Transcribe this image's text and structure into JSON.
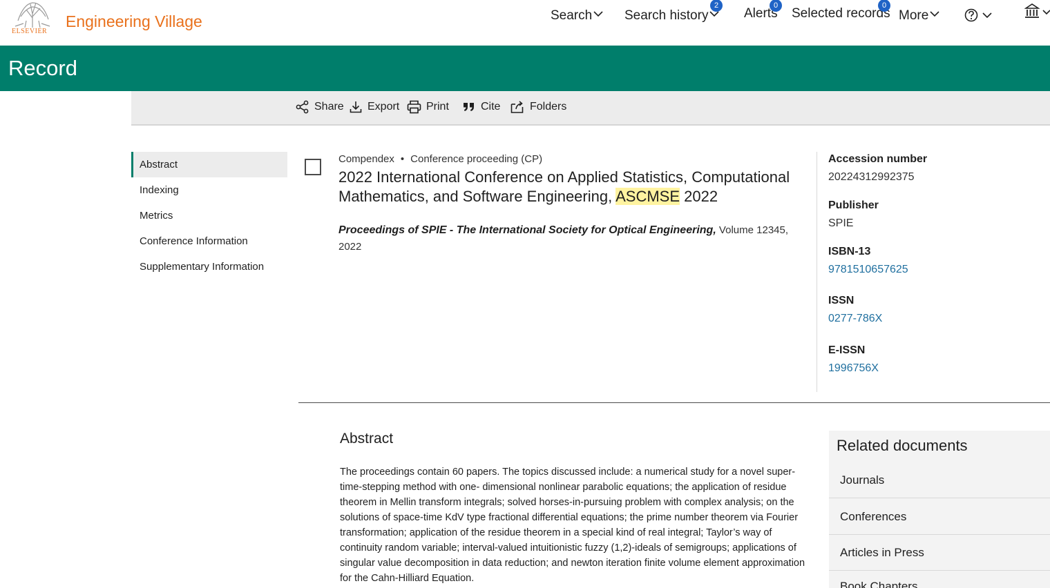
{
  "header": {
    "logo_word": "ELSEVIER",
    "brand": "Engineering Village",
    "nav": [
      {
        "label": "Search",
        "chevron": true
      },
      {
        "label": "Search history",
        "chevron": true,
        "badge": "2"
      },
      {
        "label": "Alerts",
        "badge": "0"
      },
      {
        "label": "Selected records",
        "badge": "0"
      },
      {
        "label": "More",
        "chevron": true
      }
    ],
    "help_icon": "help-circle-icon",
    "institution_icon": "institution-icon"
  },
  "banner": {
    "title": "Record"
  },
  "toolbar": {
    "items": [
      {
        "label": "Share",
        "icon": "share-icon"
      },
      {
        "label": "Export",
        "icon": "export-icon"
      },
      {
        "label": "Print",
        "icon": "print-icon"
      },
      {
        "label": "Cite",
        "icon": "cite-icon"
      },
      {
        "label": "Folders",
        "icon": "folder-icon"
      }
    ]
  },
  "sidenav": {
    "items": [
      "Abstract",
      "Indexing",
      "Metrics",
      "Conference Information",
      "Supplementary Information"
    ],
    "active_index": 0
  },
  "record": {
    "database": "Compendex",
    "doc_type": "Conference proceeding (CP)",
    "title_before": "2022 International Conference on Applied Statistics, Computational Mathematics, and Software Engineering, ",
    "title_highlight": "ASCMSE",
    "title_after": " 2022",
    "journal": "Proceedings of SPIE - The International Society for Optical Engineering,",
    "volume_year": " Volume 12345, 2022"
  },
  "meta": {
    "accession_label": "Accession number",
    "accession_value": "20224312992375",
    "publisher_label": "Publisher",
    "publisher_value": "SPIE",
    "isbn_label": "ISBN-13",
    "isbn_value": "9781510657625",
    "issn_label": "ISSN",
    "issn_value": "0277-786X",
    "eissn_label": "E-ISSN",
    "eissn_value": "1996756X"
  },
  "abstract": {
    "title": "Abstract",
    "text": "The proceedings contain 60 papers. The topics discussed include: a numerical study for a novel super-time-stepping method with one- dimensional nonlinear parabolic equations; the application of residue theorem in Mellin transform integrals; solved horses-in-pursuing problem with complex analysis; on the solutions of space-time KdV type fractional differential equations; the prime number theorem via Fourier transformation; application of the residue theorem in a special kind of real integral; Taylor’s way of continuity random variable; interval-valued intuitionistic fuzzy (1,2)-ideals of semigroups; applications of singular value decomposition in data reduction; and newton iteration finite volume element approximation for the Cahn-Hilliard Equation."
  },
  "related": {
    "title": "Related documents",
    "items": [
      "Journals",
      "Conferences",
      "Articles in Press",
      "Book Chapters"
    ]
  },
  "colors": {
    "brand_orange": "#e9711c",
    "banner_green": "#007e6b",
    "badge_blue": "#1f63c6",
    "link_blue": "#1f6f9f",
    "highlight": "#fff3a0"
  }
}
